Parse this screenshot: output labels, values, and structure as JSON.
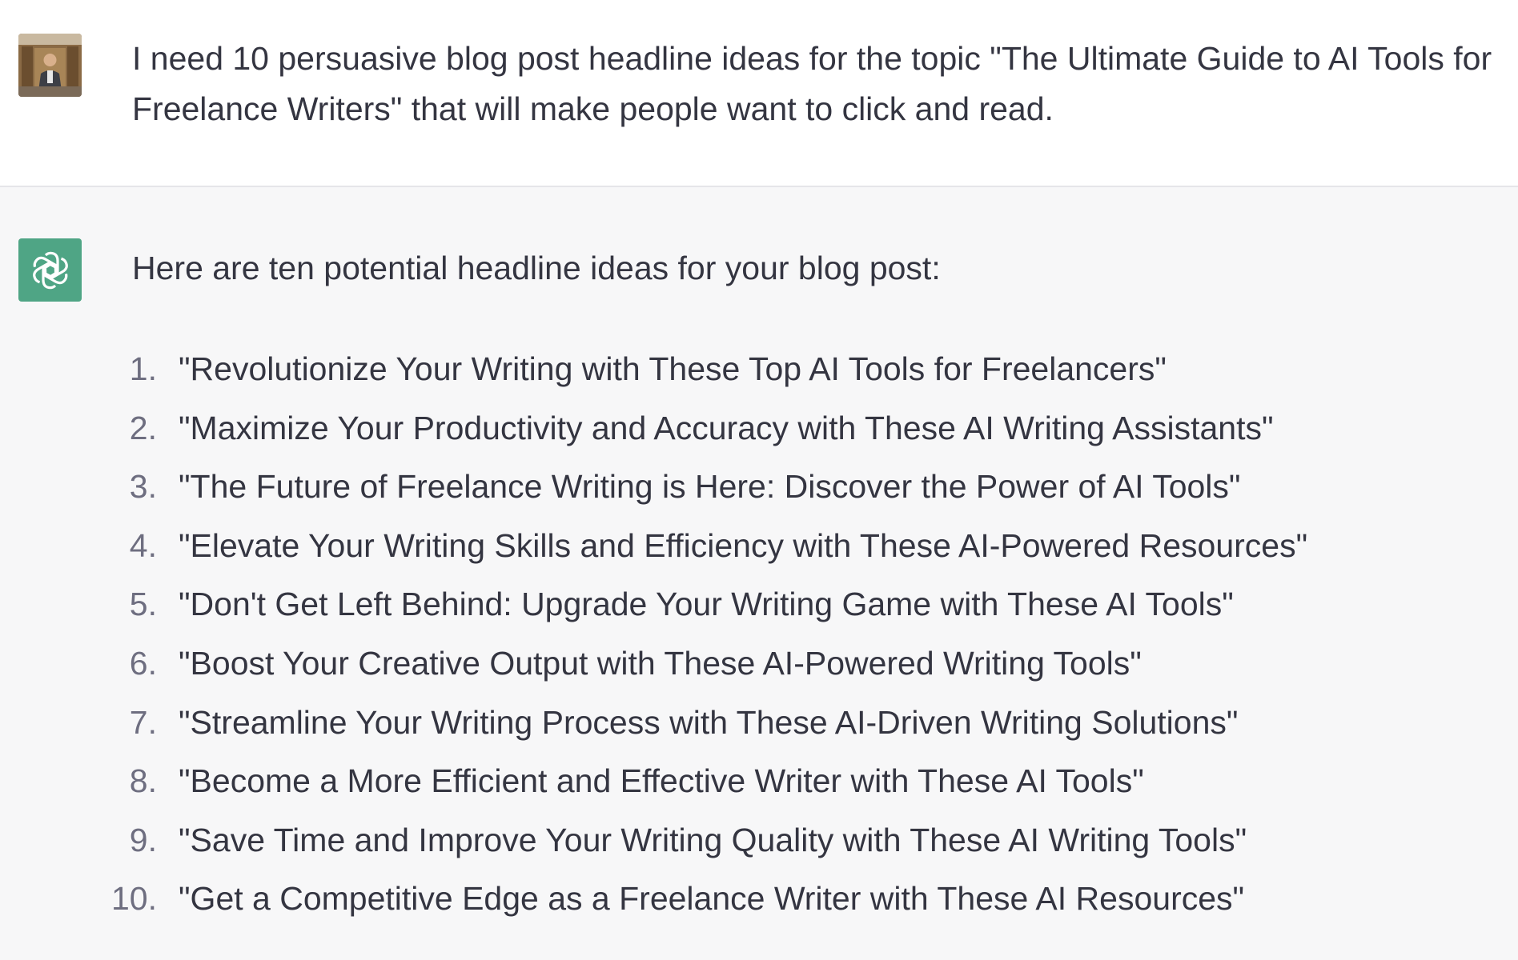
{
  "user_message": {
    "text": "I need 10 persuasive blog post headline ideas for the topic \"The Ultimate Guide to AI Tools for Freelance Writers\" that will make people want to click and read."
  },
  "assistant_message": {
    "intro": "Here are ten potential headline ideas for your blog post:",
    "headlines": [
      {
        "num": "1.",
        "text": "\"Revolutionize Your Writing with These Top AI Tools for Freelancers\""
      },
      {
        "num": "2.",
        "text": "\"Maximize Your Productivity and Accuracy with These AI Writing Assistants\""
      },
      {
        "num": "3.",
        "text": "\"The Future of Freelance Writing is Here: Discover the Power of AI Tools\""
      },
      {
        "num": "4.",
        "text": "\"Elevate Your Writing Skills and Efficiency with These AI-Powered Resources\""
      },
      {
        "num": "5.",
        "text": "\"Don't Get Left Behind: Upgrade Your Writing Game with These AI Tools\""
      },
      {
        "num": "6.",
        "text": "\"Boost Your Creative Output with These AI-Powered Writing Tools\""
      },
      {
        "num": "7.",
        "text": "\"Streamline Your Writing Process with These AI-Driven Writing Solutions\""
      },
      {
        "num": "8.",
        "text": "\"Become a More Efficient and Effective Writer with These AI Tools\""
      },
      {
        "num": "9.",
        "text": "\"Save Time and Improve Your Writing Quality with These AI Writing Tools\""
      },
      {
        "num": "10.",
        "text": "\"Get a Competitive Edge as a Freelance Writer with These AI Resources\""
      }
    ]
  },
  "colors": {
    "user_bg": "#ffffff",
    "assistant_bg": "#f7f7f8",
    "bot_avatar": "#4fa585",
    "text": "#343541",
    "number": "#6e6e80"
  },
  "icons": {
    "user_avatar": "user-avatar-icon",
    "bot_avatar": "openai-logo-icon"
  }
}
